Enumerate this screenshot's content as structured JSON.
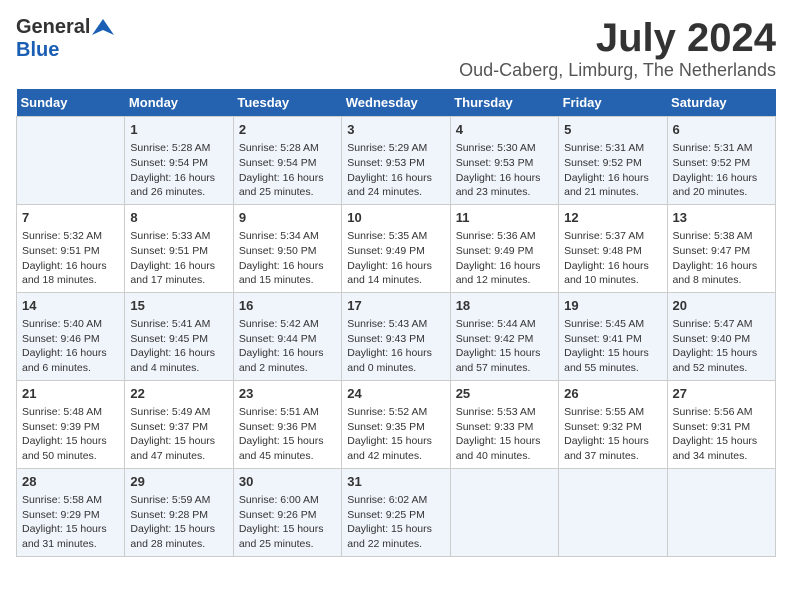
{
  "header": {
    "logo_general": "General",
    "logo_blue": "Blue",
    "title": "July 2024",
    "subtitle": "Oud-Caberg, Limburg, The Netherlands"
  },
  "calendar": {
    "days_of_week": [
      "Sunday",
      "Monday",
      "Tuesday",
      "Wednesday",
      "Thursday",
      "Friday",
      "Saturday"
    ],
    "weeks": [
      [
        {
          "day": "",
          "content": ""
        },
        {
          "day": "1",
          "content": "Sunrise: 5:28 AM\nSunset: 9:54 PM\nDaylight: 16 hours\nand 26 minutes."
        },
        {
          "day": "2",
          "content": "Sunrise: 5:28 AM\nSunset: 9:54 PM\nDaylight: 16 hours\nand 25 minutes."
        },
        {
          "day": "3",
          "content": "Sunrise: 5:29 AM\nSunset: 9:53 PM\nDaylight: 16 hours\nand 24 minutes."
        },
        {
          "day": "4",
          "content": "Sunrise: 5:30 AM\nSunset: 9:53 PM\nDaylight: 16 hours\nand 23 minutes."
        },
        {
          "day": "5",
          "content": "Sunrise: 5:31 AM\nSunset: 9:52 PM\nDaylight: 16 hours\nand 21 minutes."
        },
        {
          "day": "6",
          "content": "Sunrise: 5:31 AM\nSunset: 9:52 PM\nDaylight: 16 hours\nand 20 minutes."
        }
      ],
      [
        {
          "day": "7",
          "content": "Sunrise: 5:32 AM\nSunset: 9:51 PM\nDaylight: 16 hours\nand 18 minutes."
        },
        {
          "day": "8",
          "content": "Sunrise: 5:33 AM\nSunset: 9:51 PM\nDaylight: 16 hours\nand 17 minutes."
        },
        {
          "day": "9",
          "content": "Sunrise: 5:34 AM\nSunset: 9:50 PM\nDaylight: 16 hours\nand 15 minutes."
        },
        {
          "day": "10",
          "content": "Sunrise: 5:35 AM\nSunset: 9:49 PM\nDaylight: 16 hours\nand 14 minutes."
        },
        {
          "day": "11",
          "content": "Sunrise: 5:36 AM\nSunset: 9:49 PM\nDaylight: 16 hours\nand 12 minutes."
        },
        {
          "day": "12",
          "content": "Sunrise: 5:37 AM\nSunset: 9:48 PM\nDaylight: 16 hours\nand 10 minutes."
        },
        {
          "day": "13",
          "content": "Sunrise: 5:38 AM\nSunset: 9:47 PM\nDaylight: 16 hours\nand 8 minutes."
        }
      ],
      [
        {
          "day": "14",
          "content": "Sunrise: 5:40 AM\nSunset: 9:46 PM\nDaylight: 16 hours\nand 6 minutes."
        },
        {
          "day": "15",
          "content": "Sunrise: 5:41 AM\nSunset: 9:45 PM\nDaylight: 16 hours\nand 4 minutes."
        },
        {
          "day": "16",
          "content": "Sunrise: 5:42 AM\nSunset: 9:44 PM\nDaylight: 16 hours\nand 2 minutes."
        },
        {
          "day": "17",
          "content": "Sunrise: 5:43 AM\nSunset: 9:43 PM\nDaylight: 16 hours\nand 0 minutes."
        },
        {
          "day": "18",
          "content": "Sunrise: 5:44 AM\nSunset: 9:42 PM\nDaylight: 15 hours\nand 57 minutes."
        },
        {
          "day": "19",
          "content": "Sunrise: 5:45 AM\nSunset: 9:41 PM\nDaylight: 15 hours\nand 55 minutes."
        },
        {
          "day": "20",
          "content": "Sunrise: 5:47 AM\nSunset: 9:40 PM\nDaylight: 15 hours\nand 52 minutes."
        }
      ],
      [
        {
          "day": "21",
          "content": "Sunrise: 5:48 AM\nSunset: 9:39 PM\nDaylight: 15 hours\nand 50 minutes."
        },
        {
          "day": "22",
          "content": "Sunrise: 5:49 AM\nSunset: 9:37 PM\nDaylight: 15 hours\nand 47 minutes."
        },
        {
          "day": "23",
          "content": "Sunrise: 5:51 AM\nSunset: 9:36 PM\nDaylight: 15 hours\nand 45 minutes."
        },
        {
          "day": "24",
          "content": "Sunrise: 5:52 AM\nSunset: 9:35 PM\nDaylight: 15 hours\nand 42 minutes."
        },
        {
          "day": "25",
          "content": "Sunrise: 5:53 AM\nSunset: 9:33 PM\nDaylight: 15 hours\nand 40 minutes."
        },
        {
          "day": "26",
          "content": "Sunrise: 5:55 AM\nSunset: 9:32 PM\nDaylight: 15 hours\nand 37 minutes."
        },
        {
          "day": "27",
          "content": "Sunrise: 5:56 AM\nSunset: 9:31 PM\nDaylight: 15 hours\nand 34 minutes."
        }
      ],
      [
        {
          "day": "28",
          "content": "Sunrise: 5:58 AM\nSunset: 9:29 PM\nDaylight: 15 hours\nand 31 minutes."
        },
        {
          "day": "29",
          "content": "Sunrise: 5:59 AM\nSunset: 9:28 PM\nDaylight: 15 hours\nand 28 minutes."
        },
        {
          "day": "30",
          "content": "Sunrise: 6:00 AM\nSunset: 9:26 PM\nDaylight: 15 hours\nand 25 minutes."
        },
        {
          "day": "31",
          "content": "Sunrise: 6:02 AM\nSunset: 9:25 PM\nDaylight: 15 hours\nand 22 minutes."
        },
        {
          "day": "",
          "content": ""
        },
        {
          "day": "",
          "content": ""
        },
        {
          "day": "",
          "content": ""
        }
      ]
    ]
  }
}
